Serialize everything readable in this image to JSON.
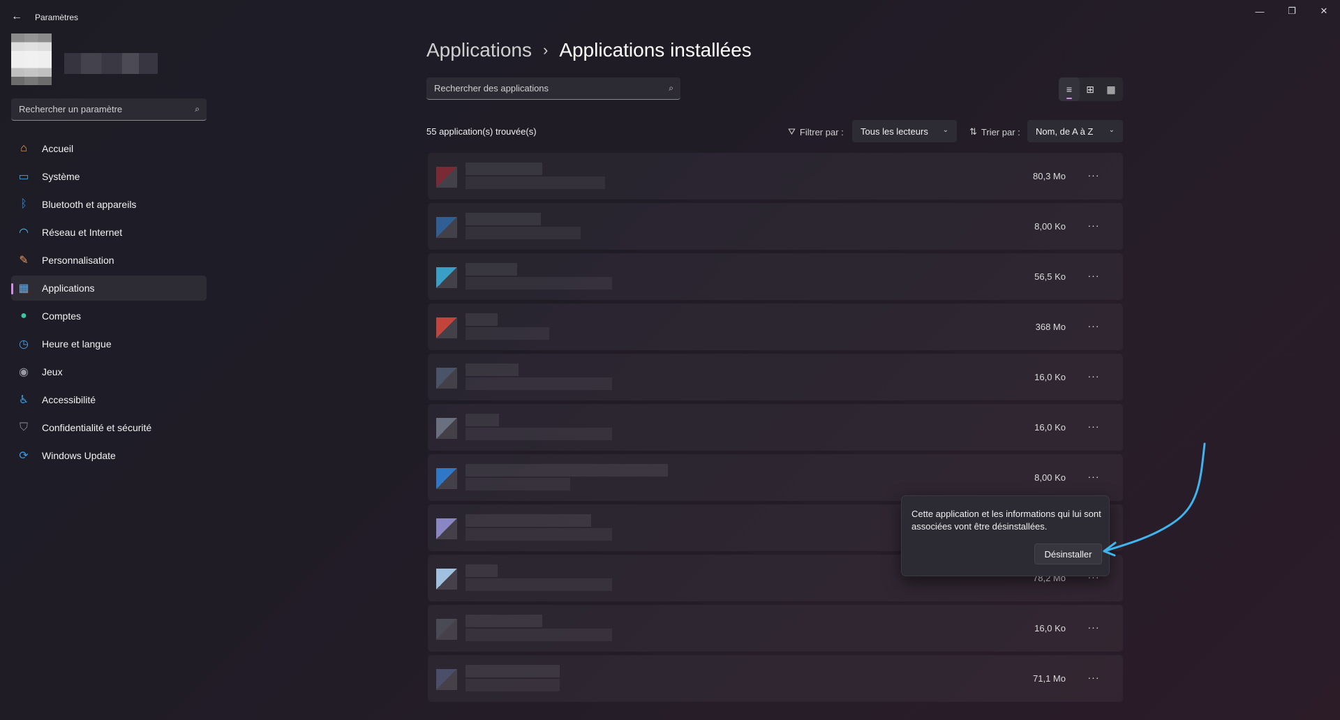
{
  "window": {
    "title": "Paramètres",
    "back_icon": "←",
    "minimize_icon": "—",
    "restore_icon": "❐",
    "close_icon": "✕"
  },
  "sidebar": {
    "search_placeholder": "Rechercher un paramètre",
    "search_icon": "⌕",
    "items": [
      {
        "label": "Accueil",
        "icon": "home-icon",
        "glyph": "⌂",
        "color": "#f0a35e"
      },
      {
        "label": "Système",
        "icon": "system-icon",
        "glyph": "▭",
        "color": "#3fa6e8"
      },
      {
        "label": "Bluetooth et appareils",
        "icon": "bluetooth-icon",
        "glyph": "ᛒ",
        "color": "#2f8de0"
      },
      {
        "label": "Réseau et Internet",
        "icon": "wifi-icon",
        "glyph": "◠",
        "color": "#5ab6ea"
      },
      {
        "label": "Personnalisation",
        "icon": "brush-icon",
        "glyph": "✎",
        "color": "#e79a5f"
      },
      {
        "label": "Applications",
        "icon": "apps-icon",
        "glyph": "▦",
        "color": "#6fa8dc"
      },
      {
        "label": "Comptes",
        "icon": "accounts-icon",
        "glyph": "●",
        "color": "#3cc5a0"
      },
      {
        "label": "Heure et langue",
        "icon": "globe-clock-icon",
        "glyph": "◷",
        "color": "#4aa3e6"
      },
      {
        "label": "Jeux",
        "icon": "gamepad-icon",
        "glyph": "◉",
        "color": "#9a9aa5"
      },
      {
        "label": "Accessibilité",
        "icon": "accessibility-icon",
        "glyph": "♿",
        "color": "#3aa0e8"
      },
      {
        "label": "Confidentialité et sécurité",
        "icon": "shield-icon",
        "glyph": "⛉",
        "color": "#8f8f99"
      },
      {
        "label": "Windows Update",
        "icon": "windows-update-icon",
        "glyph": "⟳",
        "color": "#3a9be6"
      }
    ],
    "active_index": 5
  },
  "main": {
    "breadcrumb_parent": "Applications",
    "breadcrumb_sep": "›",
    "breadcrumb_current": "Applications installées",
    "search_placeholder": "Rechercher des applications",
    "search_icon": "⌕",
    "view_icons": [
      "≡",
      "⊞",
      "▦"
    ],
    "count_text": "55 application(s) trouvée(s)",
    "filter_label": "Filtrer par :",
    "filter_icon": "⛛",
    "filter_value": "Tous les lecteurs",
    "sort_label": "Trier par :",
    "sort_icon": "⇅",
    "sort_value": "Nom, de A à Z",
    "chevron": "⌄",
    "apps": [
      {
        "size": "80,3 Mo",
        "icon_color": "#7a2a35"
      },
      {
        "size": "8,00 Ko",
        "icon_color": "#2f5f95"
      },
      {
        "size": "56,5 Ko",
        "icon_color": "#3a9fc7"
      },
      {
        "size": "368 Mo",
        "icon_color": "#c2443a"
      },
      {
        "size": "16,0 Ko",
        "icon_color": "#4a5468"
      },
      {
        "size": "16,0 Ko",
        "icon_color": "#6a7080"
      },
      {
        "size": "8,00 Ko",
        "icon_color": "#2f78c8"
      },
      {
        "size": "",
        "icon_color": "#8a86c4"
      },
      {
        "size": "78,2 Mo",
        "icon_color": "#9fc0de"
      },
      {
        "size": "16,0 Ko",
        "icon_color": "#4a4a55"
      },
      {
        "size": "71,1 Mo",
        "icon_color": "#4a4e68"
      }
    ],
    "more_icon": "···"
  },
  "flyout": {
    "text": "Cette application et les informations qui lui sont associées vont être désinstallées.",
    "button": "Désinstaller"
  },
  "accent_color": "#d28ee6",
  "annotation_arrow_color": "#3fb4ee"
}
